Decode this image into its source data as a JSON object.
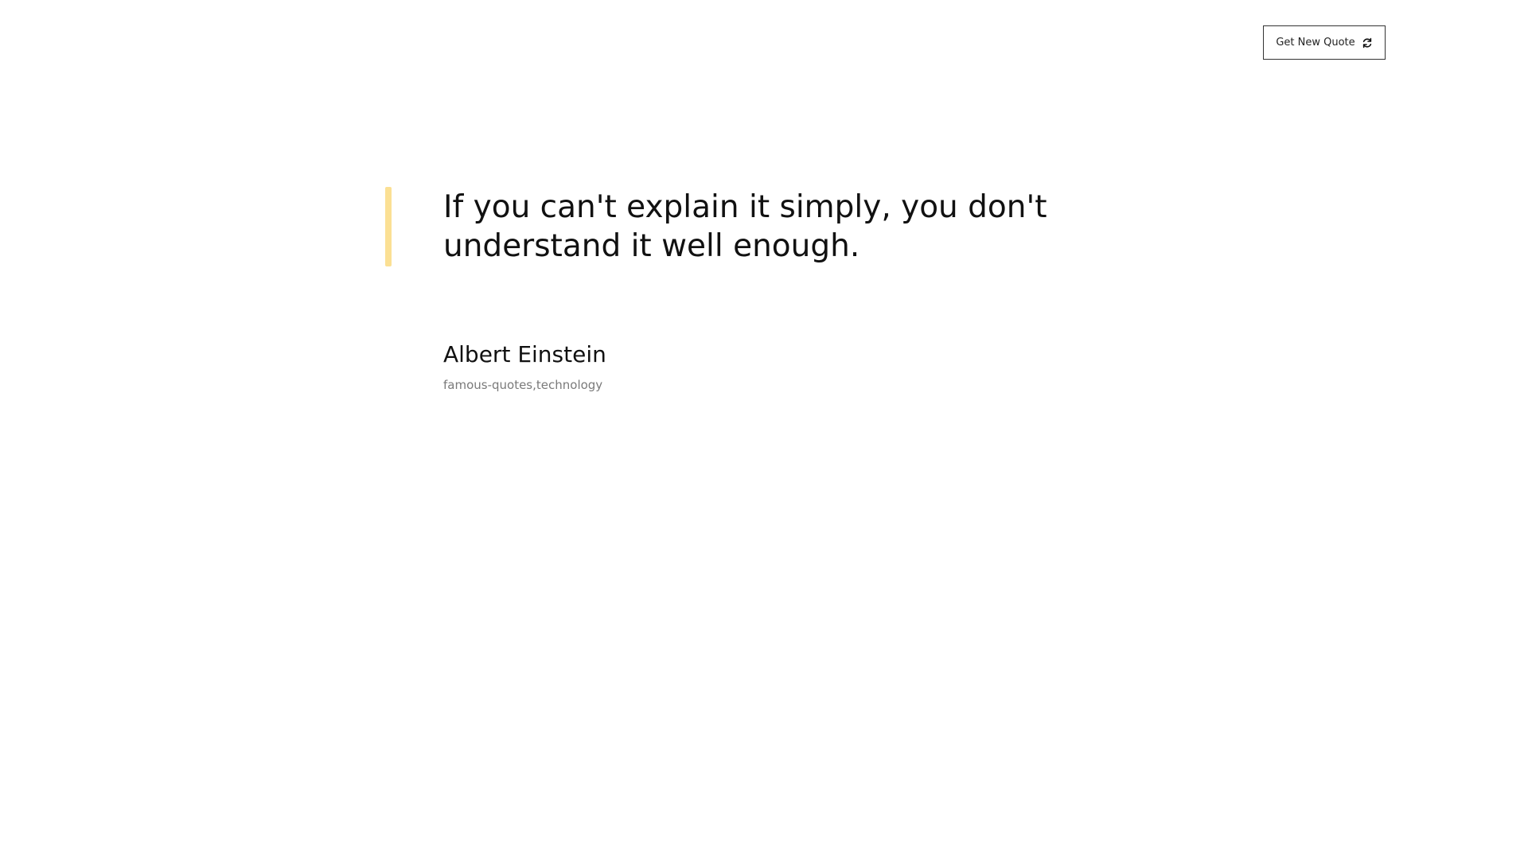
{
  "header": {
    "new_quote_label": "Get New Quote",
    "new_quote_icon": "refresh-icon"
  },
  "quote": {
    "text": "If you can't explain it simply, you don't understand it well enough.",
    "author": "Albert Einstein",
    "tags": "famous-quotes,technology"
  },
  "colors": {
    "accent_bar": "#fbe094",
    "text": "#111111",
    "tags": "#7a7a7a",
    "button_border": "#333333"
  }
}
